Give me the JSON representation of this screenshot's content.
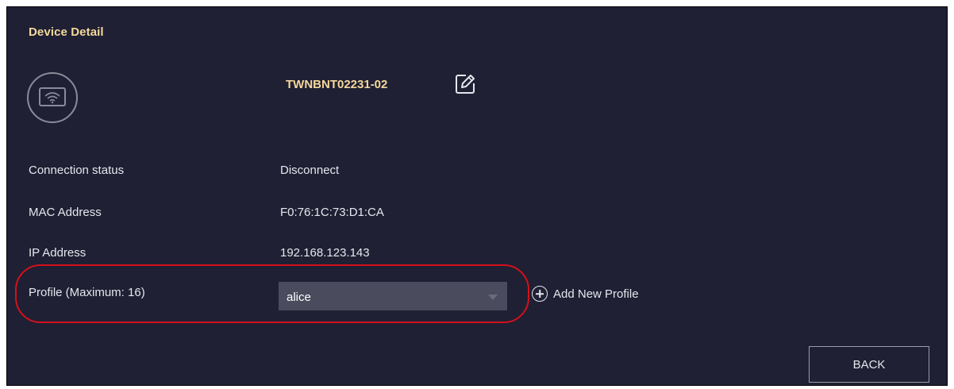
{
  "page_title": "Device Detail",
  "device": {
    "name": "TWNBNT02231-02",
    "icon": "wifi-device-icon",
    "edit_icon": "edit-icon"
  },
  "details": [
    {
      "label": "Connection status",
      "value": "Disconnect"
    },
    {
      "label": "MAC Address",
      "value": "F0:76:1C:73:D1:CA"
    },
    {
      "label": "IP Address",
      "value": "192.168.123.143"
    }
  ],
  "profile": {
    "label": "Profile (Maximum: 16)",
    "selected": "alice",
    "add_label": "Add New Profile",
    "add_icon": "plus-circle-icon"
  },
  "back_label": "BACK",
  "colors": {
    "background": "#1f2033",
    "accent_title": "#f5d89a",
    "highlight": "#d4101c",
    "select_bg": "#4a4b5c"
  }
}
